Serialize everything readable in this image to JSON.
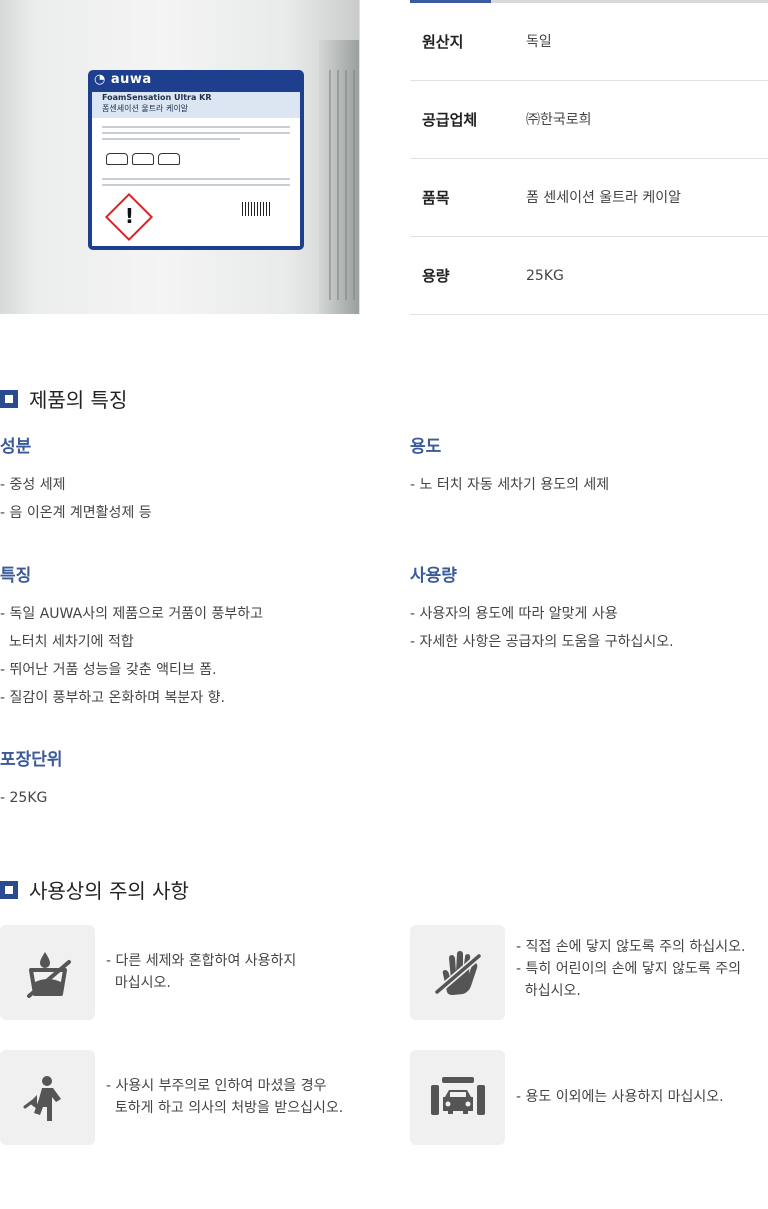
{
  "photo": {
    "brand": "auwa",
    "label_title": "FoamSensation Ultra KR",
    "label_subtitle": "폼센세이션 울트라 케이알",
    "hazard_symbol": "!"
  },
  "spec": [
    {
      "key": "원산지",
      "value": "독일"
    },
    {
      "key": "공급업체",
      "value": "㈜한국로희"
    },
    {
      "key": "품목",
      "value": "폼 센세이션 울트라 케이알"
    },
    {
      "key": "용량",
      "value": "25KG"
    }
  ],
  "features": {
    "title": "제품의 특징",
    "ingredients": {
      "title": "성분",
      "lines": [
        "- 중성 세제",
        "- 음 이온계 계면활성제 등"
      ]
    },
    "usage": {
      "title": "용도",
      "lines": [
        "- 노 터치 자동 세차기 용도의 세제"
      ]
    },
    "characteristics": {
      "title": "특징",
      "lines": [
        "- 독일 AUWA사의 제품으로 거품이 풍부하고",
        "  노터치 세차기에 적합",
        "- 뛰어난 거품 성능을 갖춘 액티브 폼.",
        "- 질감이 풍부하고 온화하며 복분자 향."
      ]
    },
    "amount": {
      "title": "사용량",
      "lines": [
        "- 사용자의 용도에 따라 알맞게 사용",
        "- 자세한 사항은 공급자의 도움을 구하십시오."
      ]
    },
    "packaging": {
      "title": "포장단위",
      "lines": [
        "- 25KG"
      ]
    }
  },
  "caution": {
    "title": "사용상의 주의 사항",
    "items": [
      {
        "icon": "no-mixing-icon",
        "text": "- 다른 세제와 혼합하여 사용하지\n  마십시오."
      },
      {
        "icon": "no-hand-contact-icon",
        "text": "- 직접 손에 닿지 않도록 주의 하십시오.\n- 특히 어린이의 손에 닿지 않도록 주의\n  하십시오."
      },
      {
        "icon": "swallow-warning-icon",
        "text": "- 사용시 부주의로 인하여 마셨을 경우\n  토하게 하고 의사의 처방을 받으십시오."
      },
      {
        "icon": "car-wash-icon",
        "text": "- 용도 이외에는 사용하지 마십시오."
      }
    ]
  },
  "colors": {
    "accent": "#3b5a9a",
    "heading_square": "#2a4c8f",
    "icon_box": "#f0f0f0",
    "icon": "#555555"
  }
}
